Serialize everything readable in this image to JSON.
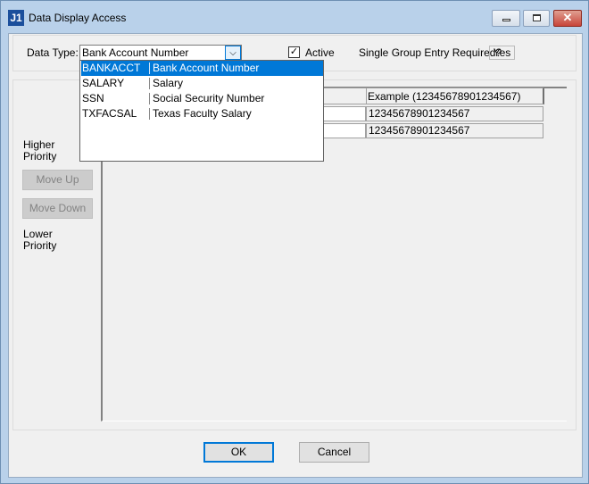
{
  "window": {
    "title": "Data Display Access",
    "app_icon": "J1"
  },
  "filter": {
    "data_type_label": "Data Type:",
    "data_type_value": "Bank Account Number",
    "active_label": "Active",
    "active_checked": true,
    "single_group_label": "Single Group Entry Required?",
    "single_group_value": "Yes"
  },
  "dropdown": {
    "options": [
      {
        "code": "BANKACCT",
        "desc": "Bank Account Number",
        "selected": true
      },
      {
        "code": "SALARY",
        "desc": "Salary"
      },
      {
        "code": "SSN",
        "desc": "Social Security Number"
      },
      {
        "code": "TXFACSAL",
        "desc": "Texas Faculty Salary"
      }
    ]
  },
  "priority": {
    "higher": "Higher Priority",
    "lower": "Lower Priority",
    "move_up": "Move Up",
    "move_down": "Move Down"
  },
  "grid": {
    "columns": [
      "Example (12345678901234567)"
    ],
    "rows": [
      [
        "12345678901234567"
      ],
      [
        "12345678901234567"
      ]
    ]
  },
  "footer": {
    "ok": "OK",
    "cancel": "Cancel"
  },
  "colors": {
    "accent": "#0078d7",
    "close": "#c8453a"
  }
}
